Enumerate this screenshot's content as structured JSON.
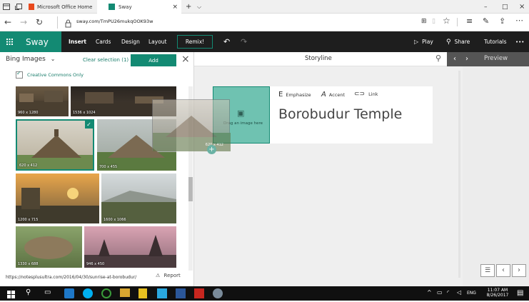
{
  "browser": {
    "tabs": [
      {
        "label": "Microsoft Office Home"
      },
      {
        "label": "Sway"
      }
    ],
    "address": "sway.com/TmPU26mukqOOK93w",
    "window_controls": [
      "–",
      "□",
      "×"
    ]
  },
  "ribbon": {
    "app_name": "Sway",
    "menu": [
      "Insert",
      "Cards",
      "Design",
      "Layout"
    ],
    "remix": "Remix!",
    "play": "Play",
    "share": "Share",
    "tutorials": "Tutorials",
    "more": "•••"
  },
  "left_pane": {
    "source": "Bing Images",
    "clear_selection": "Clear selection (1)",
    "add": "Add",
    "creative_commons": "Creative Commons Only",
    "thumbs": [
      {
        "label": "960 x 1280"
      },
      {
        "label": "1536 x 1024"
      },
      {
        "label": "620 x 412"
      },
      {
        "label": "700 x 455"
      },
      {
        "label": "1200 x 715"
      },
      {
        "label": "1600 x 1066"
      },
      {
        "label": "1330 x 688"
      },
      {
        "label": "946 x 450"
      }
    ],
    "drag_label": "620 x 412",
    "source_url": "https://notesplusultra.com/2016/04/30/sunrise-at-borobudur/",
    "report": "Report"
  },
  "storyline": {
    "title": "Storyline",
    "drop_hint": "Drag an image here",
    "tools": {
      "emphasize": "Emphasize",
      "accent": "Accent",
      "link": "Link"
    },
    "heading": "Borobudur Temple"
  },
  "preview": {
    "title": "Preview"
  },
  "taskbar": {
    "lang": "ENG",
    "time": "11:07 AM",
    "date": "8/26/2017"
  },
  "colors": {
    "accent": "#138a73",
    "ribbon": "#1e1e1e",
    "link": "#1a7d6b"
  }
}
